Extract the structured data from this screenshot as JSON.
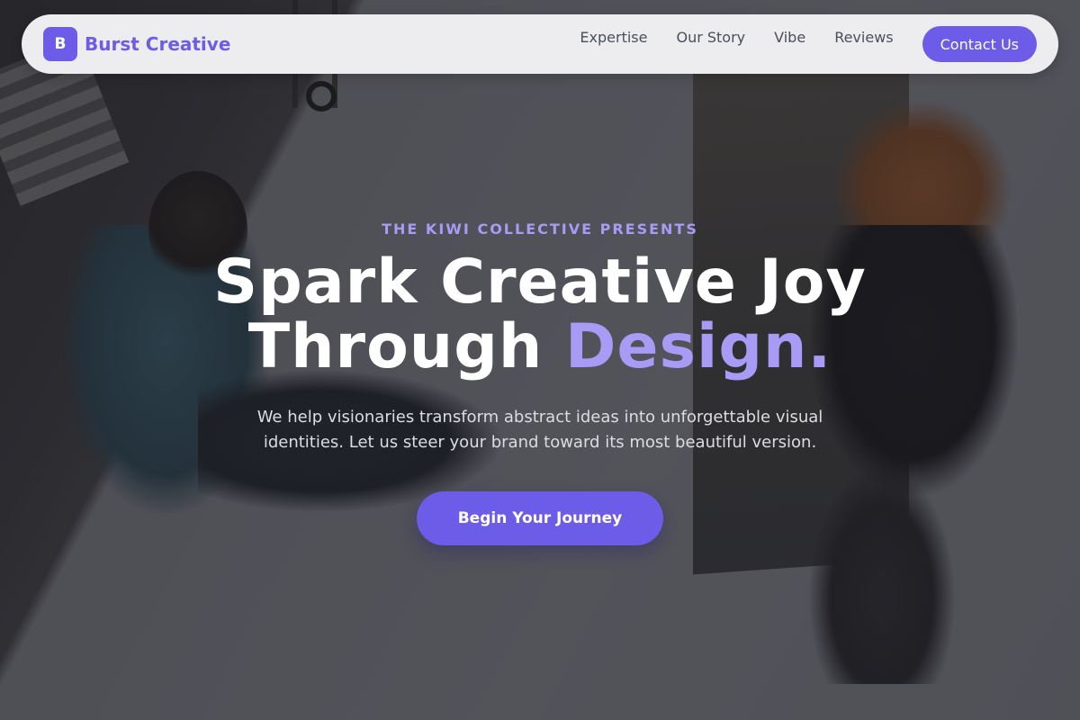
{
  "brand": {
    "mark": "B",
    "name": "Burst Creative"
  },
  "nav": {
    "links": [
      "Expertise",
      "Our Story",
      "Vibe",
      "Reviews"
    ],
    "contact_label": "Contact Us"
  },
  "hero": {
    "eyebrow": "THE KIWI COLLECTIVE PRESENTS",
    "headline_line1": "Spark Creative Joy",
    "headline_line2_plain": "Through ",
    "headline_line2_accent": "Design.",
    "subtext": "We help visionaries transform abstract ideas into unforgettable visual identities. Let us steer your brand toward its most beautiful version.",
    "cta_label": "Begin Your Journey"
  },
  "colors": {
    "accent": "#6c5ce7",
    "accent_light": "#a79bf6"
  }
}
